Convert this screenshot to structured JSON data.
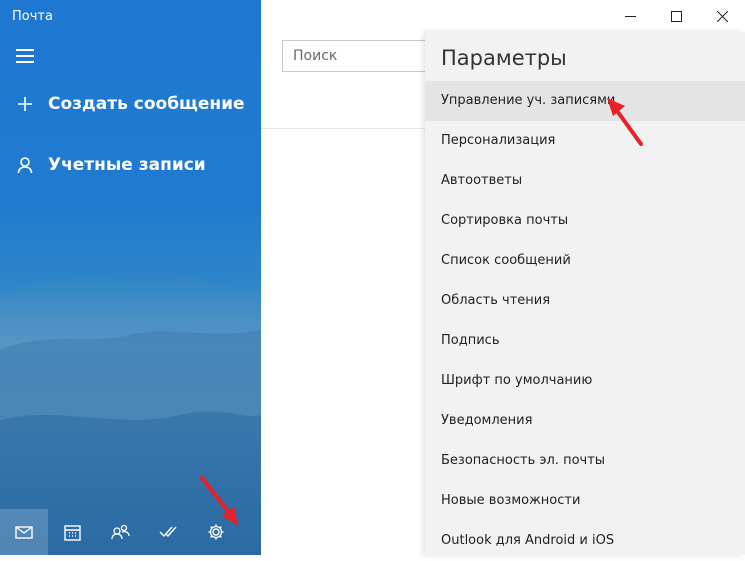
{
  "app": {
    "title": "Почта"
  },
  "sidebar": {
    "new_message": "Создать сообщение",
    "accounts": "Учетные записи",
    "bottom_icons": [
      "mail-icon",
      "calendar-icon",
      "people-icon",
      "todo-icon",
      "settings-gear-icon"
    ]
  },
  "search": {
    "placeholder": "Поиск"
  },
  "settings": {
    "title": "Параметры",
    "items": [
      "Управление уч. записями",
      "Персонализация",
      "Автоответы",
      "Сортировка почты",
      "Список сообщений",
      "Область чтения",
      "Подпись",
      "Шрифт по умолчанию",
      "Уведомления",
      "Безопасность эл. почты",
      "Новые возможности",
      "Outlook для Android и iOS"
    ]
  },
  "colors": {
    "sidebar_blue": "#1e78d2",
    "arrow_red": "#e8202a",
    "panel_bg": "#f2f2f2"
  }
}
